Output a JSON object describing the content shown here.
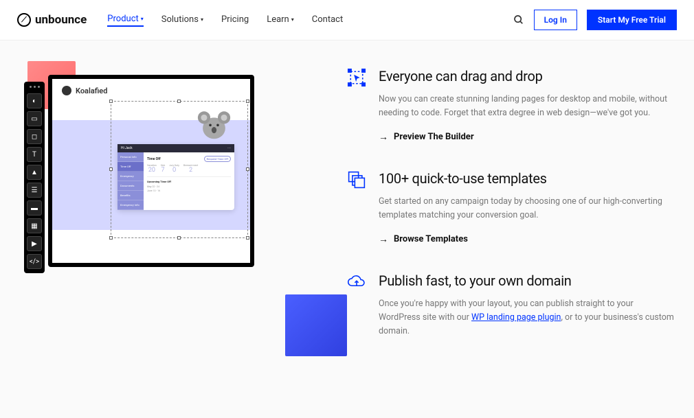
{
  "brand": "unbounce",
  "nav": {
    "product": "Product",
    "solutions": "Solutions",
    "pricing": "Pricing",
    "learn": "Learn",
    "contact": "Contact"
  },
  "header": {
    "login": "Log In",
    "trial": "Start My Free Trial"
  },
  "builder": {
    "brand": "Koalafied",
    "panel": {
      "user": "Hi Jack",
      "request_btn": "Request Time Off",
      "side": [
        "Personal Info",
        "Time Off",
        "Emergency",
        "Documents",
        "Benefits",
        "Emergency Info"
      ],
      "title": "Time Off",
      "stats": [
        {
          "label": "Vacation",
          "value": "20"
        },
        {
          "label": "Sick",
          "value": "7"
        },
        {
          "label": "Jury Duty",
          "value": "0"
        },
        {
          "label": "Bereave-ment",
          "value": "2"
        }
      ],
      "upcoming": "Upcoming Time Off",
      "dates": [
        "May 22 - 24",
        "June 13 - 16"
      ]
    }
  },
  "features": [
    {
      "title": "Everyone can drag and drop",
      "desc": "Now you can create stunning landing pages for desktop and mobile, without needing to code. Forget that extra degree in web design—we've got you.",
      "cta": "Preview The Builder"
    },
    {
      "title": "100+ quick-to-use templates",
      "desc": "Get started on any campaign today by choosing one of our high-converting templates matching your conversion goal.",
      "cta": "Browse Templates"
    },
    {
      "title": "Publish fast, to your own domain",
      "desc_pre": "Once you're happy with your layout, you can publish straight to your WordPress site with our ",
      "desc_link": "WP landing page plugin",
      "desc_post": ", or to your business's custom domain."
    }
  ]
}
